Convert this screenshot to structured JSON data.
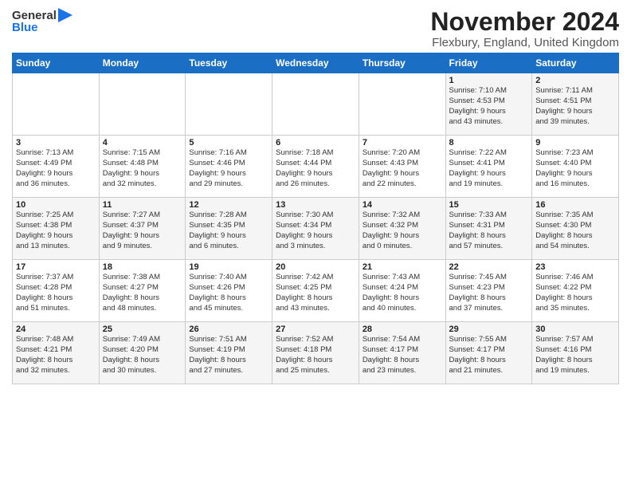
{
  "logo": {
    "line1": "General",
    "line2": "Blue"
  },
  "title": "November 2024",
  "location": "Flexbury, England, United Kingdom",
  "days_of_week": [
    "Sunday",
    "Monday",
    "Tuesday",
    "Wednesday",
    "Thursday",
    "Friday",
    "Saturday"
  ],
  "weeks": [
    [
      {
        "day": "",
        "info": ""
      },
      {
        "day": "",
        "info": ""
      },
      {
        "day": "",
        "info": ""
      },
      {
        "day": "",
        "info": ""
      },
      {
        "day": "",
        "info": ""
      },
      {
        "day": "1",
        "info": "Sunrise: 7:10 AM\nSunset: 4:53 PM\nDaylight: 9 hours\nand 43 minutes."
      },
      {
        "day": "2",
        "info": "Sunrise: 7:11 AM\nSunset: 4:51 PM\nDaylight: 9 hours\nand 39 minutes."
      }
    ],
    [
      {
        "day": "3",
        "info": "Sunrise: 7:13 AM\nSunset: 4:49 PM\nDaylight: 9 hours\nand 36 minutes."
      },
      {
        "day": "4",
        "info": "Sunrise: 7:15 AM\nSunset: 4:48 PM\nDaylight: 9 hours\nand 32 minutes."
      },
      {
        "day": "5",
        "info": "Sunrise: 7:16 AM\nSunset: 4:46 PM\nDaylight: 9 hours\nand 29 minutes."
      },
      {
        "day": "6",
        "info": "Sunrise: 7:18 AM\nSunset: 4:44 PM\nDaylight: 9 hours\nand 26 minutes."
      },
      {
        "day": "7",
        "info": "Sunrise: 7:20 AM\nSunset: 4:43 PM\nDaylight: 9 hours\nand 22 minutes."
      },
      {
        "day": "8",
        "info": "Sunrise: 7:22 AM\nSunset: 4:41 PM\nDaylight: 9 hours\nand 19 minutes."
      },
      {
        "day": "9",
        "info": "Sunrise: 7:23 AM\nSunset: 4:40 PM\nDaylight: 9 hours\nand 16 minutes."
      }
    ],
    [
      {
        "day": "10",
        "info": "Sunrise: 7:25 AM\nSunset: 4:38 PM\nDaylight: 9 hours\nand 13 minutes."
      },
      {
        "day": "11",
        "info": "Sunrise: 7:27 AM\nSunset: 4:37 PM\nDaylight: 9 hours\nand 9 minutes."
      },
      {
        "day": "12",
        "info": "Sunrise: 7:28 AM\nSunset: 4:35 PM\nDaylight: 9 hours\nand 6 minutes."
      },
      {
        "day": "13",
        "info": "Sunrise: 7:30 AM\nSunset: 4:34 PM\nDaylight: 9 hours\nand 3 minutes."
      },
      {
        "day": "14",
        "info": "Sunrise: 7:32 AM\nSunset: 4:32 PM\nDaylight: 9 hours\nand 0 minutes."
      },
      {
        "day": "15",
        "info": "Sunrise: 7:33 AM\nSunset: 4:31 PM\nDaylight: 8 hours\nand 57 minutes."
      },
      {
        "day": "16",
        "info": "Sunrise: 7:35 AM\nSunset: 4:30 PM\nDaylight: 8 hours\nand 54 minutes."
      }
    ],
    [
      {
        "day": "17",
        "info": "Sunrise: 7:37 AM\nSunset: 4:28 PM\nDaylight: 8 hours\nand 51 minutes."
      },
      {
        "day": "18",
        "info": "Sunrise: 7:38 AM\nSunset: 4:27 PM\nDaylight: 8 hours\nand 48 minutes."
      },
      {
        "day": "19",
        "info": "Sunrise: 7:40 AM\nSunset: 4:26 PM\nDaylight: 8 hours\nand 45 minutes."
      },
      {
        "day": "20",
        "info": "Sunrise: 7:42 AM\nSunset: 4:25 PM\nDaylight: 8 hours\nand 43 minutes."
      },
      {
        "day": "21",
        "info": "Sunrise: 7:43 AM\nSunset: 4:24 PM\nDaylight: 8 hours\nand 40 minutes."
      },
      {
        "day": "22",
        "info": "Sunrise: 7:45 AM\nSunset: 4:23 PM\nDaylight: 8 hours\nand 37 minutes."
      },
      {
        "day": "23",
        "info": "Sunrise: 7:46 AM\nSunset: 4:22 PM\nDaylight: 8 hours\nand 35 minutes."
      }
    ],
    [
      {
        "day": "24",
        "info": "Sunrise: 7:48 AM\nSunset: 4:21 PM\nDaylight: 8 hours\nand 32 minutes."
      },
      {
        "day": "25",
        "info": "Sunrise: 7:49 AM\nSunset: 4:20 PM\nDaylight: 8 hours\nand 30 minutes."
      },
      {
        "day": "26",
        "info": "Sunrise: 7:51 AM\nSunset: 4:19 PM\nDaylight: 8 hours\nand 27 minutes."
      },
      {
        "day": "27",
        "info": "Sunrise: 7:52 AM\nSunset: 4:18 PM\nDaylight: 8 hours\nand 25 minutes."
      },
      {
        "day": "28",
        "info": "Sunrise: 7:54 AM\nSunset: 4:17 PM\nDaylight: 8 hours\nand 23 minutes."
      },
      {
        "day": "29",
        "info": "Sunrise: 7:55 AM\nSunset: 4:17 PM\nDaylight: 8 hours\nand 21 minutes."
      },
      {
        "day": "30",
        "info": "Sunrise: 7:57 AM\nSunset: 4:16 PM\nDaylight: 8 hours\nand 19 minutes."
      }
    ]
  ]
}
